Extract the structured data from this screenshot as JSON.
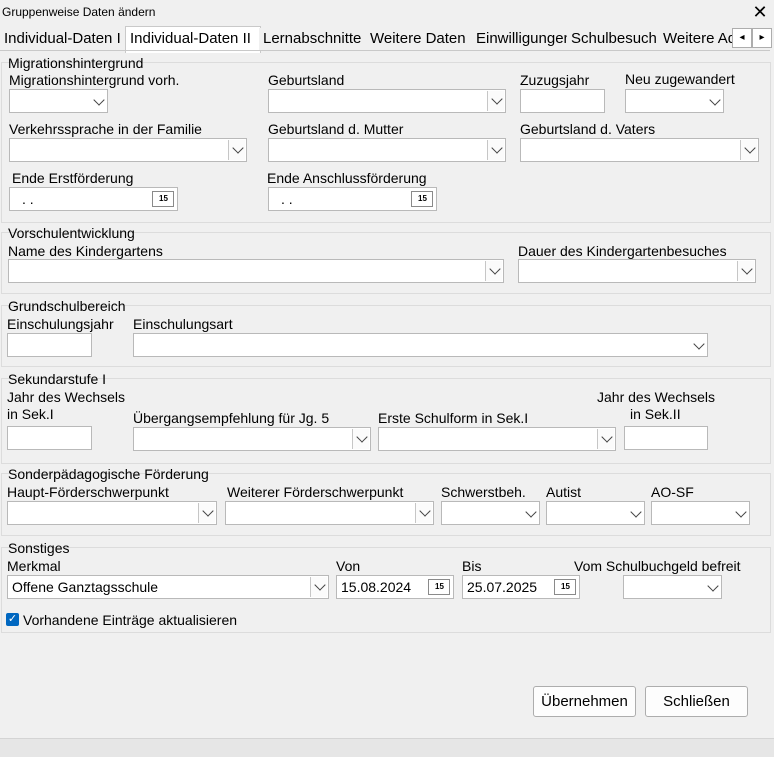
{
  "window": {
    "title": "Gruppenweise Daten ändern",
    "close_glyph": "✕"
  },
  "tabs": [
    {
      "label": "Individual-Daten I"
    },
    {
      "label": "Individual-Daten II"
    },
    {
      "label": "Lernabschnitte"
    },
    {
      "label": "Weitere Daten"
    },
    {
      "label": "Einwilligungen"
    },
    {
      "label": "Schulbesuch"
    },
    {
      "label": "Weitere Ad"
    }
  ],
  "tab_scroll": {
    "left": "◂",
    "right": "▸"
  },
  "migration": {
    "title": "Migrationshintergrund",
    "vorh": "Migrationshintergrund vorh.",
    "geburtsland": "Geburtsland",
    "zuzugsjahr": "Zuzugsjahr",
    "neu": "Neu zugewandert",
    "verkehrssprache": "Verkehrssprache in der Familie",
    "geb_mutter": "Geburtsland d. Mutter",
    "geb_vater": "Geburtsland d. Vaters",
    "ende_erst": "Ende Erstförderung",
    "ende_anschluss": "Ende Anschlussförderung",
    "date_empty": " .  ."
  },
  "vorschule": {
    "title": "Vorschulentwicklung",
    "kindergarten": "Name des Kindergartens",
    "dauer": "Dauer des Kindergartenbesuches"
  },
  "grundschule": {
    "title": "Grundschulbereich",
    "jahr": "Einschulungsjahr",
    "art": "Einschulungsart"
  },
  "sek1": {
    "title": "Sekundarstufe I",
    "wechsel1_a": "Jahr des Wechsels",
    "wechsel1_b": "in Sek.I",
    "empfehlung": "Übergangsempfehlung für Jg. 5",
    "schulform": "Erste Schulform in Sek.I",
    "wechsel2_a": "Jahr des Wechsels",
    "wechsel2_b": "in Sek.II"
  },
  "sonder": {
    "title": "Sonderpädagogische Förderung",
    "haupt": "Haupt-Förderschwerpunkt",
    "weiterer": "Weiterer Förderschwerpunkt",
    "schwerst": "Schwerstbeh.",
    "autist": "Autist",
    "aosf": "AO-SF"
  },
  "sonstiges": {
    "title": "Sonstiges",
    "merkmal": "Merkmal",
    "merkmal_value": "Offene Ganztagsschule",
    "von": "Von",
    "von_value": "15.08.2024",
    "bis": "Bis",
    "bis_value": "25.07.2025",
    "buchgeld": "Vom Schulbuchgeld befreit"
  },
  "checkbox": {
    "label": "Vorhandene Einträge aktualisieren",
    "checked": true,
    "glyph": "✓"
  },
  "calendar_glyph": "15",
  "buttons": {
    "apply": "Übernehmen",
    "close": "Schließen"
  }
}
